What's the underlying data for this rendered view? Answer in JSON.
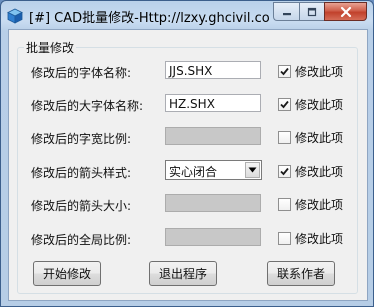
{
  "window": {
    "title": "[#] CAD批量修改-Http://lzxy.ghcivil.co...",
    "icon": "app-cube-icon"
  },
  "group": {
    "title": "批量修改"
  },
  "rows": [
    {
      "label": "修改后的字体名称:",
      "value": "JJS.SHX",
      "enabled": true,
      "checkbox_label": "修改此项",
      "checked": true
    },
    {
      "label": "修改后的大字体名称:",
      "value": "HZ.SHX",
      "enabled": true,
      "checkbox_label": "修改此项",
      "checked": true
    },
    {
      "label": "修改后的字宽比例:",
      "value": "",
      "enabled": false,
      "checkbox_label": "修改此项",
      "checked": false
    },
    {
      "label": "修改后的箭头样式:",
      "value": "实心闭合",
      "enabled": true,
      "checkbox_label": "修改此项",
      "checked": true
    },
    {
      "label": "修改后的箭头大小:",
      "value": "",
      "enabled": false,
      "checkbox_label": "修改此项",
      "checked": false
    },
    {
      "label": "修改后的全局比例:",
      "value": "",
      "enabled": false,
      "checkbox_label": "修改此项",
      "checked": false
    }
  ],
  "buttons": {
    "start": "开始修改",
    "exit": "退出程序",
    "contact": "联系作者"
  }
}
